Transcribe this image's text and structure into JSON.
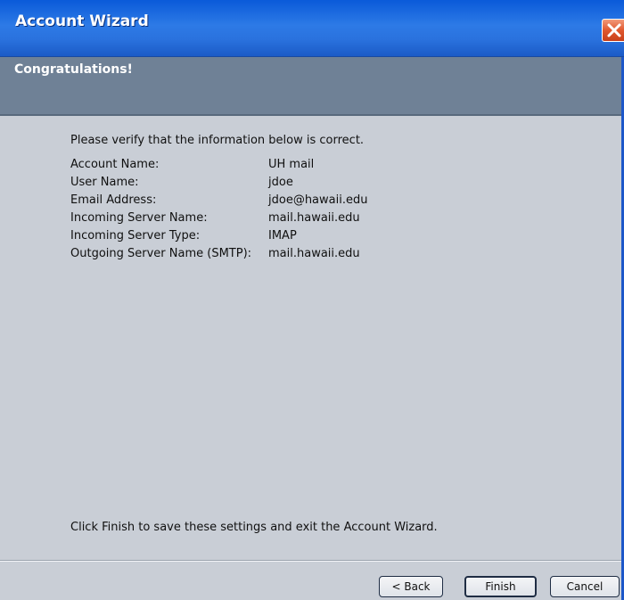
{
  "window": {
    "title": "Account Wizard",
    "subtitle": "Congratulations!"
  },
  "intro": "Please verify that the information below is correct.",
  "info": [
    {
      "label": "Account Name:",
      "value": "UH mail"
    },
    {
      "label": "User Name:",
      "value": "jdoe"
    },
    {
      "label": "Email Address:",
      "value": "jdoe@hawaii.edu"
    },
    {
      "label": "Incoming Server Name:",
      "value": "mail.hawaii.edu"
    },
    {
      "label": "Incoming Server Type:",
      "value": "IMAP"
    },
    {
      "label": "Outgoing Server Name (SMTP):",
      "value": "mail.hawaii.edu"
    }
  ],
  "footer": "Click Finish to save these settings and exit the Account Wizard.",
  "buttons": {
    "back": "< Back",
    "finish": "Finish",
    "cancel": "Cancel"
  },
  "colors": {
    "titlebar": "#2a72de",
    "header_band": "#6f8196",
    "body": "#c9ced6",
    "close": "#e0582f"
  },
  "icons": {
    "close": "close-icon"
  }
}
